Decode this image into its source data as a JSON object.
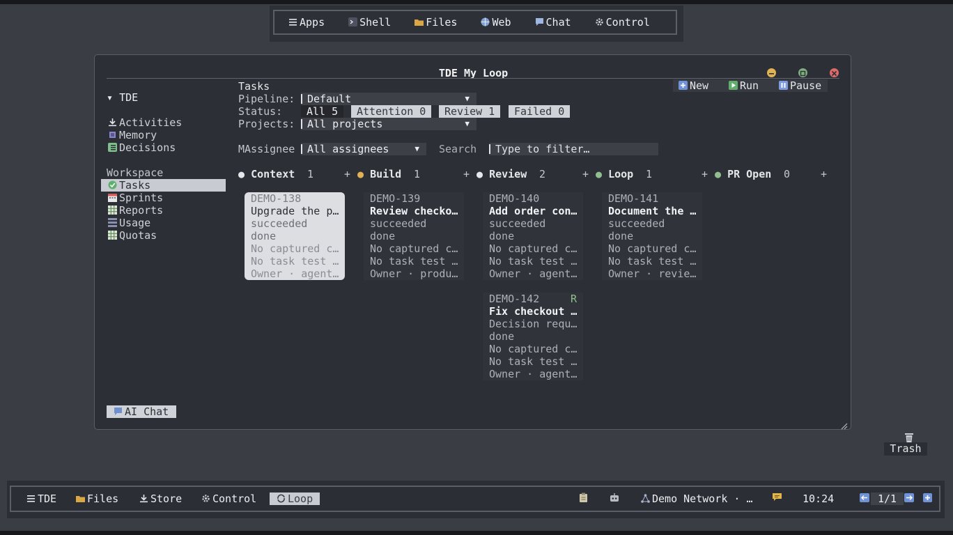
{
  "launcher": {
    "items": [
      {
        "label": "Apps",
        "icon": "menu-icon"
      },
      {
        "label": "Shell",
        "icon": "terminal-icon"
      },
      {
        "label": "Files",
        "icon": "folder-icon"
      },
      {
        "label": "Web",
        "icon": "globe-icon"
      },
      {
        "label": "Chat",
        "icon": "chat-icon"
      },
      {
        "label": "Control",
        "icon": "gear-icon"
      }
    ]
  },
  "window": {
    "title": "TDE My Loop",
    "controls": {
      "minimize_color": "#e0b254",
      "maximize_color": "#7fae7f",
      "close_color": "#e06a6a"
    }
  },
  "sidebar": {
    "group_label": "TDE",
    "group_caret": "▾",
    "items": [
      {
        "label": "Activities",
        "icon": "download-icon"
      },
      {
        "label": "Memory",
        "icon": "memory-icon"
      },
      {
        "label": "Decisions",
        "icon": "checklist-icon"
      }
    ],
    "workspace_label": "Workspace",
    "workspace_items": [
      {
        "label": "Tasks",
        "icon": "check-circle-icon",
        "selected": true
      },
      {
        "label": "Sprints",
        "icon": "calendar-icon"
      },
      {
        "label": "Reports",
        "icon": "grid-icon"
      },
      {
        "label": "Usage",
        "icon": "bars-icon"
      },
      {
        "label": "Quotas",
        "icon": "grid-icon"
      }
    ],
    "ai_chat": "AI Chat"
  },
  "toolbar": {
    "new": "New",
    "run": "Run",
    "pause": "Pause"
  },
  "filters": {
    "heading": "Tasks",
    "pipeline_label": "Pipeline:",
    "pipeline_value": "Default",
    "status_label": "Status:",
    "status_chips": [
      "All 5",
      "Attention 0",
      "Review 1",
      "Failed 0"
    ],
    "projects_label": "Projects:",
    "projects_value": "All projects",
    "assignee_label": "MAssignee",
    "assignee_value": "All assignees",
    "search_label": "Search",
    "search_placeholder": "Type to filter…"
  },
  "columns": [
    {
      "name": "Context",
      "count": "1",
      "bullet": "●",
      "bullet_color": "#e6e7ea",
      "add": "+"
    },
    {
      "name": "Build",
      "count": "1",
      "bullet": "●",
      "bullet_color": "#e0b254",
      "add": "+"
    },
    {
      "name": "Review",
      "count": "2",
      "bullet": "●",
      "bullet_color": "#e6e7ea",
      "add": "+"
    },
    {
      "name": "Loop",
      "count": "1",
      "bullet": "●",
      "bullet_color": "#8fbf8f",
      "add": "+"
    },
    {
      "name": "PR Open",
      "count": "0",
      "bullet": "●",
      "bullet_color": "#8fbf8f",
      "add": "+"
    }
  ],
  "cards": [
    {
      "id": "DEMO-138",
      "title": "Upgrade the p…",
      "status": "succeeded",
      "state": "done",
      "captured": "No captured c…",
      "tests": "No task test …",
      "owner": "Owner · agent…",
      "flag": ""
    },
    {
      "id": "DEMO-139",
      "title": "Review checko…",
      "status": "succeeded",
      "state": "done",
      "captured": "No captured c…",
      "tests": "No task test …",
      "owner": "Owner · produ…",
      "flag": ""
    },
    {
      "id": "DEMO-140",
      "title": "Add order con…",
      "status": "succeeded",
      "state": "done",
      "captured": "No captured c…",
      "tests": "No task test …",
      "owner": "Owner · agent…",
      "flag": ""
    },
    {
      "id": "DEMO-141",
      "title": "Document the …",
      "status": "succeeded",
      "state": "done",
      "captured": "No captured c…",
      "tests": "No task test …",
      "owner": "Owner · revie…",
      "flag": ""
    },
    {
      "id": "DEMO-142",
      "title": "Fix checkout …",
      "status": "Decision requ…",
      "state": "done",
      "captured": "No captured c…",
      "tests": "No task test …",
      "owner": "Owner · agent…",
      "flag": "R"
    }
  ],
  "desktop": {
    "trash": "Trash"
  },
  "taskbar": {
    "items": [
      {
        "label": "TDE",
        "icon": "menu-icon"
      },
      {
        "label": "Files",
        "icon": "folder-icon"
      },
      {
        "label": "Store",
        "icon": "download-icon"
      },
      {
        "label": "Control",
        "icon": "gear-icon"
      },
      {
        "label": "Loop",
        "icon": "loop-icon",
        "active": true
      }
    ],
    "network": "Demo Network · …",
    "clock": "10:24",
    "pager": "1/1"
  }
}
